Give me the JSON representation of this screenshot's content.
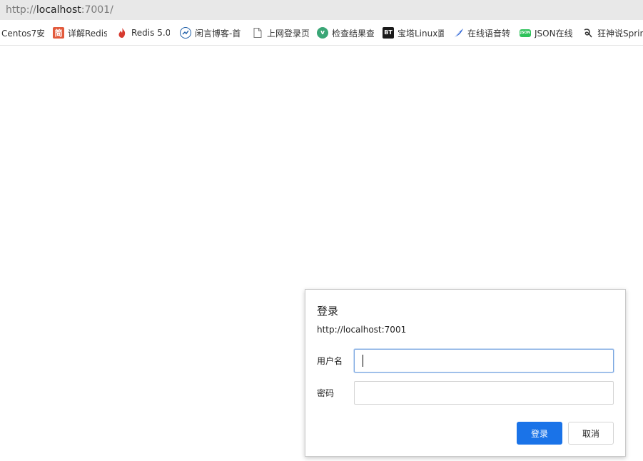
{
  "address_bar": {
    "url_prefix": "http://",
    "url_host": "localhost",
    "url_suffix": ":7001/"
  },
  "bookmarks": [
    {
      "label": "Centos7安",
      "icon": "none"
    },
    {
      "label": "详解Redis",
      "icon": "jian-icon",
      "icon_text": "简"
    },
    {
      "label": "Redis 5.0",
      "icon": "redis-flame-icon"
    },
    {
      "label": "闲言博客-首",
      "icon": "blog-icon"
    },
    {
      "label": "上网登录页",
      "icon": "page-icon"
    },
    {
      "label": "检查结果查",
      "icon": "v-icon",
      "icon_text": "v"
    },
    {
      "label": "宝塔Linux面",
      "icon": "bt-icon",
      "icon_text": "BT"
    },
    {
      "label": "在线语音转",
      "icon": "feather-icon"
    },
    {
      "label": "JSON在线",
      "icon": "json-icon",
      "icon_text": "JSON"
    },
    {
      "label": "狂神说Sprin",
      "icon": "kuang-icon"
    }
  ],
  "dialog": {
    "title": "登录",
    "origin": "http://localhost:7001",
    "username_label": "用户名",
    "username_value": "",
    "password_label": "密码",
    "password_value": "",
    "login_button": "登录",
    "cancel_button": "取消"
  },
  "colors": {
    "primary_button": "#1a73e8",
    "focus_border": "#7aa6e0",
    "address_bar_bg": "#e8e8e8"
  }
}
